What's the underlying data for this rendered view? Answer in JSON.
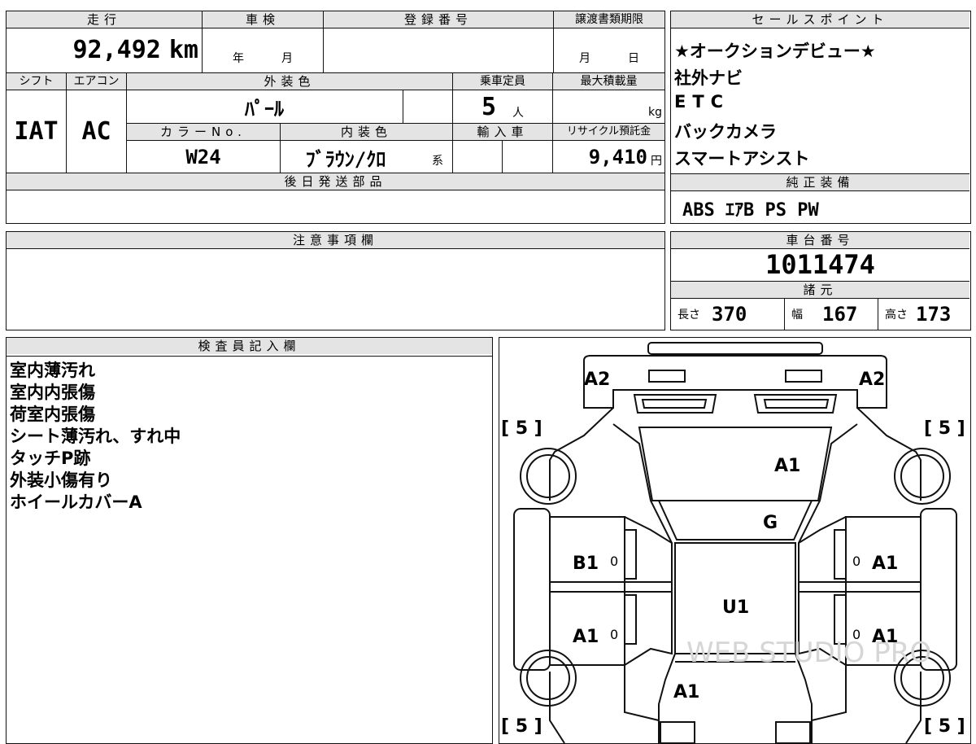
{
  "vehicle": {
    "headers": {
      "mileage": "走行",
      "inspection": "車検",
      "registration_no": "登録番号",
      "transfer_deadline": "譲渡書類期限",
      "shift": "シフト",
      "aircon": "エアコン",
      "exterior_color": "外装色",
      "capacity": "乗車定員",
      "max_load": "最大積載量",
      "color_no": "カラーNo.",
      "interior_color": "内装色",
      "import": "輸入車",
      "recycle_fee": "リサイクル預託金",
      "later_parts": "後日発送部品"
    },
    "mileage_value": "92,492",
    "mileage_unit": "km",
    "year_label": "年",
    "month_label": "月",
    "day_label": "日",
    "shift_value": "IAT",
    "aircon_value": "AC",
    "exterior_color_value": "ﾊﾟｰﾙ",
    "capacity_value": "5",
    "capacity_unit": "人",
    "max_load_unit": "kg",
    "color_no_value": "W24",
    "interior_color_value": "ﾌﾞﾗｳﾝ/ｸﾛ",
    "interior_color_suffix": "系",
    "recycle_value": "9,410",
    "recycle_unit": "円"
  },
  "sales_points": {
    "header": "セールスポイント",
    "items": [
      "★オークションデビュー★",
      "社外ナビ",
      "ETC",
      "バックカメラ",
      "スマートアシスト"
    ]
  },
  "standard_equipment": {
    "header": "純正装備",
    "value": "ABS ｴｱB PS PW"
  },
  "notes": {
    "header": "注意事項欄"
  },
  "chassis": {
    "header": "車台番号",
    "value": "1011474"
  },
  "specs": {
    "header": "諸元",
    "length_label": "長さ",
    "length_value": "370",
    "width_label": "幅",
    "width_value": "167",
    "height_label": "高さ",
    "height_value": "173"
  },
  "inspector": {
    "header": "検査員記入欄",
    "lines": [
      "室内薄汚れ",
      "室内内張傷",
      "荷室内張傷",
      "シート薄汚れ、すれ中",
      "タッチP跡",
      "外装小傷有り",
      "ホイールカバーA"
    ]
  },
  "diagram": {
    "labels": {
      "front_left": "A2",
      "front_right": "A2",
      "hood": "A1",
      "windshield": "G",
      "roof": "U1",
      "rear_door_left": "B1",
      "rear_door_right": "A1",
      "front_door_left": "A1",
      "front_door_right": "A1",
      "back_door": "A1"
    },
    "tire_tl": "[ 5 ]",
    "tire_tr": "[ 5 ]",
    "tire_bl": "[ 5 ]",
    "tire_br": "[ 5 ]",
    "mark_zero": "0",
    "watermark": "WEB STUDIO PRO"
  },
  "colors": {
    "header_bg": "#e4e4e4",
    "border": "#111111"
  }
}
